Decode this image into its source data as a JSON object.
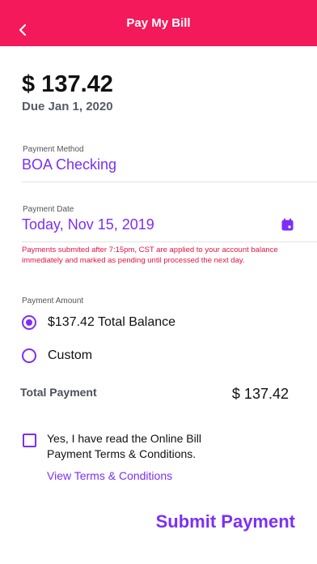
{
  "header": {
    "title": "Pay My Bill",
    "back_icon": "chevron-left-icon"
  },
  "bill": {
    "amount": "$ 137.42",
    "due": "Due Jan 1, 2020"
  },
  "payment_method": {
    "label": "Payment Method",
    "value": "BOA Checking"
  },
  "payment_date": {
    "label": "Payment Date",
    "value": "Today, Nov 15, 2019",
    "icon": "calendar-icon",
    "warning": "Payments submited after 7:15pm, CST are applied to your account balance immediately and marked as pending until processed the next day."
  },
  "payment_amount": {
    "label": "Payment Amount",
    "options": [
      {
        "label": "$137.42 Total Balance",
        "selected": true
      },
      {
        "label": "Custom",
        "selected": false
      }
    ]
  },
  "total": {
    "label": "Total Payment",
    "value": "$ 137.42"
  },
  "terms": {
    "checked": false,
    "text": "Yes, I have read the Online Bill Payment Terms & Conditions.",
    "link": "View Terms & Conditions"
  },
  "submit_label": "Submit Payment",
  "colors": {
    "header": "#f3195a",
    "accent": "#7b2ff7",
    "warning": "#e0143f"
  }
}
